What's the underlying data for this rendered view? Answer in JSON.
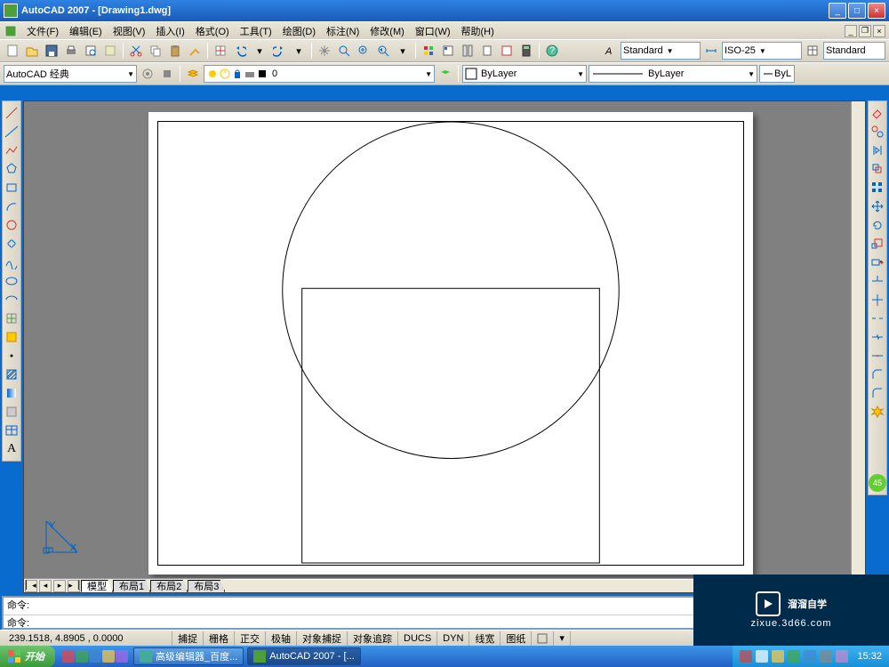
{
  "title": "AutoCAD 2007 - [Drawing1.dwg]",
  "menus": [
    "文件(F)",
    "编辑(E)",
    "视图(V)",
    "插入(I)",
    "格式(O)",
    "工具(T)",
    "绘图(D)",
    "标注(N)",
    "修改(M)",
    "窗口(W)",
    "帮助(H)"
  ],
  "style_group": {
    "text_style": "Standard",
    "dim_style": "ISO-25",
    "table_style": "Standard"
  },
  "workspace": "AutoCAD 经典",
  "layer": {
    "current": "0",
    "color_prop": "ByLayer",
    "linetype": "ByLayer",
    "lineweight": "ByL"
  },
  "tabs": [
    "模型",
    "布局1",
    "布局2",
    "布局3"
  ],
  "active_tab": 0,
  "cmd1": "命令:",
  "cmd2": "命令:",
  "coords": "239.1518, 4.8905 , 0.0000",
  "status_toggles": [
    "捕捉",
    "栅格",
    "正交",
    "极轴",
    "对象捕捉",
    "对象追踪",
    "DUCS",
    "DYN",
    "线宽",
    "图纸"
  ],
  "task_items": [
    {
      "icon": "#4a9",
      "label": "高级编辑器_百度..."
    },
    {
      "icon": "#4e9e3a",
      "label": "AutoCAD 2007 - [..."
    }
  ],
  "start": "开始",
  "clock": "15:32",
  "watermark": {
    "brand": "溜溜自学",
    "url": "zixue.3d66.com"
  }
}
